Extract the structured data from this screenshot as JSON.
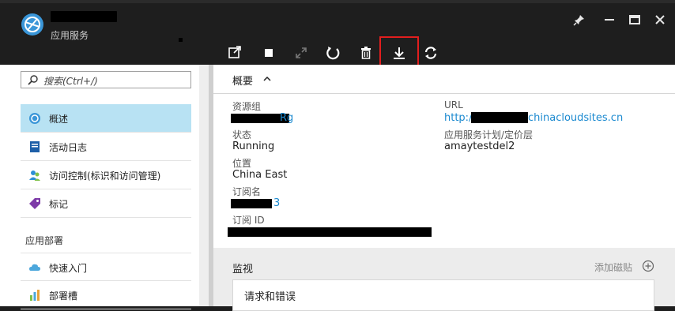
{
  "header": {
    "app_subtitle": "应用服务"
  },
  "toolbar": {
    "items": [
      "browse-icon",
      "stop-icon",
      "swap-icon",
      "restart-icon",
      "delete-icon",
      "download-icon",
      "refresh-icon"
    ]
  },
  "sidebar": {
    "search_placeholder": "搜索(Ctrl+/)",
    "items": [
      {
        "label": "概述",
        "icon": "overview-icon"
      },
      {
        "label": "活动日志",
        "icon": "activity-log-icon"
      },
      {
        "label": "访问控制(标识和访问管理)",
        "icon": "access-control-icon"
      },
      {
        "label": "标记",
        "icon": "tag-icon"
      }
    ],
    "section_deploy": "应用部署",
    "deploy_items": [
      {
        "label": "快速入门",
        "icon": "cloud-icon"
      },
      {
        "label": "部署槽",
        "icon": "chart-icon"
      }
    ]
  },
  "overview": {
    "title": "概要",
    "resource_group_label": "资源组",
    "resource_group_value_suffix": "Rg",
    "status_label": "状态",
    "status_value": "Running",
    "location_label": "位置",
    "location_value": "China East",
    "subscription_label": "订阅名",
    "subscription_value_suffix": "3",
    "subscription_id_label": "订阅 ID",
    "url_label": "URL",
    "url_prefix": "http://",
    "url_suffix": "chinacloudsites.cn",
    "plan_label": "应用服务计划/定价层",
    "plan_value": "amaytestdel2"
  },
  "monitor": {
    "title": "监视",
    "add_tile": "添加磁贴",
    "card_title": "请求和错误"
  },
  "colors": {
    "accent": "#1c8ad0",
    "highlight": "#e21e1e",
    "active_nav": "#b8e2f3"
  }
}
